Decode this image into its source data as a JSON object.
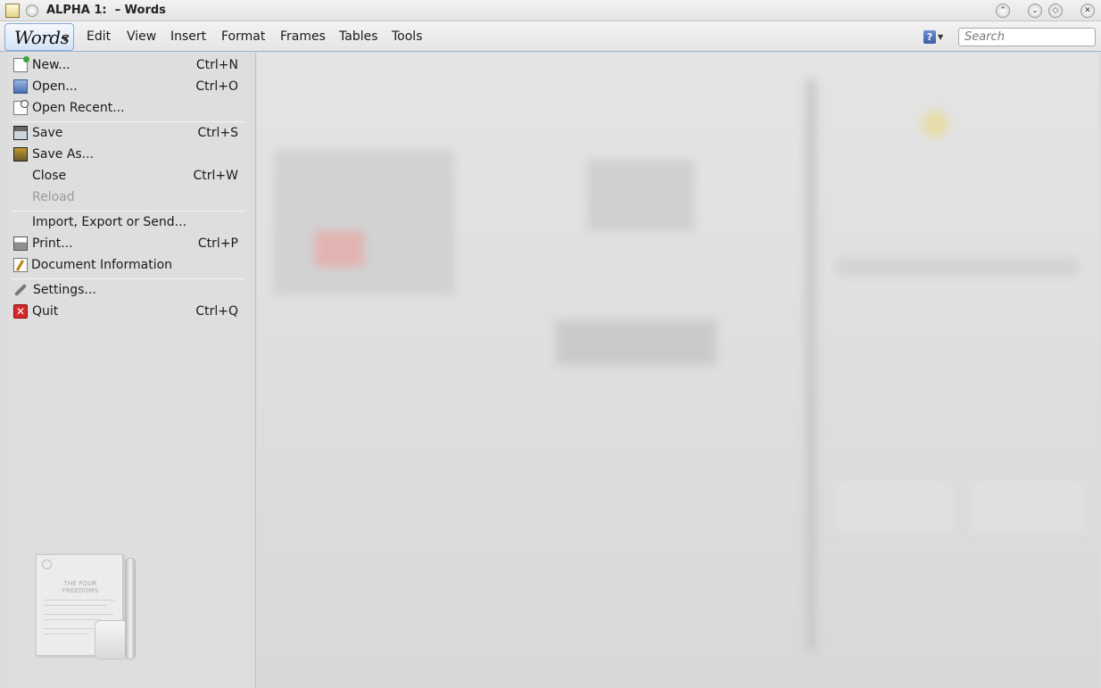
{
  "window": {
    "title": "ALPHA 1:  – Words",
    "buttons": {
      "keep_above": "⌃",
      "minimize": "⌄",
      "maximize": "◇",
      "close": "✕"
    }
  },
  "menubar": {
    "app_menu_label": "Words",
    "items": [
      {
        "label": "Edit"
      },
      {
        "label": "View"
      },
      {
        "label": "Insert"
      },
      {
        "label": "Format"
      },
      {
        "label": "Frames"
      },
      {
        "label": "Tables"
      },
      {
        "label": "Tools"
      }
    ],
    "help_label": "?",
    "search_placeholder": "Search"
  },
  "dropdown": {
    "items": [
      {
        "label": "New...",
        "shortcut": "Ctrl+N",
        "icon": "new-document-icon",
        "enabled": true
      },
      {
        "label": "Open...",
        "shortcut": "Ctrl+O",
        "icon": "open-folder-icon",
        "enabled": true
      },
      {
        "label": "Open Recent...",
        "shortcut": "",
        "icon": "open-recent-icon",
        "enabled": true
      },
      {
        "label": "Save",
        "shortcut": "Ctrl+S",
        "icon": "save-icon",
        "enabled": true
      },
      {
        "label": "Save As...",
        "shortcut": "",
        "icon": "save-as-icon",
        "enabled": true
      },
      {
        "label": "Close",
        "shortcut": "Ctrl+W",
        "icon": "",
        "enabled": true
      },
      {
        "label": "Reload",
        "shortcut": "",
        "icon": "",
        "enabled": false
      },
      {
        "label": "Import, Export or Send...",
        "shortcut": "",
        "icon": "",
        "enabled": true
      },
      {
        "label": "Print...",
        "shortcut": "Ctrl+P",
        "icon": "printer-icon",
        "enabled": true
      },
      {
        "label": "Document Information",
        "shortcut": "",
        "icon": "document-info-icon",
        "enabled": true
      },
      {
        "label": "Settings...",
        "shortcut": "",
        "icon": "wrench-icon",
        "enabled": true
      },
      {
        "label": "Quit",
        "shortcut": "Ctrl+Q",
        "icon": "quit-icon",
        "enabled": true
      }
    ],
    "illustration": {
      "icon": "four-freedoms-illustration-icon",
      "paper_heading": "THE FOUR FREEDOMS"
    }
  },
  "colors": {
    "menu_bg": "#dedede",
    "accent": "#8aa9d6",
    "quit_red": "#d42a2a"
  }
}
